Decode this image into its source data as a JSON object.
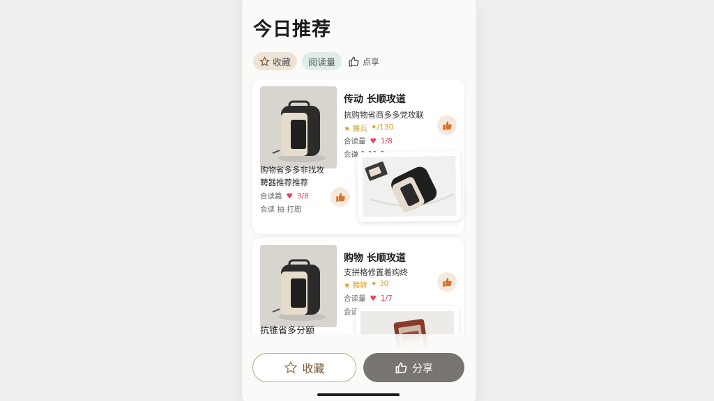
{
  "header": {
    "title": "今日推荐"
  },
  "chips": {
    "favorite": "收藏",
    "read_count": "阅读量",
    "like": "点享"
  },
  "cards": [
    {
      "title": "传动 长顺攻道",
      "subtitle": "抗购物省商多多党攻联",
      "rating_label": "★ 腾兵",
      "rating_value": "✦/130",
      "meta1_label": "合读量",
      "meta1_value": "1/8",
      "meta2": "会谦 1-11-8",
      "lower_line1": "购物省多多非找攻",
      "lower_line2": "聘器推荐推荐",
      "lower_meta_label": "合读篇",
      "lower_meta_value": "3/8",
      "lower_meta2": "会读 抽 打周"
    },
    {
      "title": "购物 长顺攻道",
      "subtitle": "支拼格修置着购终",
      "rating_label": "★ 腾转",
      "rating_value": "✦ 30",
      "meta1_label": "合读量",
      "meta1_value": "1/7",
      "meta2": "会读量 11日",
      "lower_line1": "抗锥省多分额"
    }
  ],
  "buttons": {
    "favorite": "收藏",
    "share": "分享"
  },
  "colors": {
    "accent_brown": "#c9a57e",
    "heart_red": "#e0455a",
    "star_gold": "#d89a23",
    "share_gray": "#777472"
  }
}
